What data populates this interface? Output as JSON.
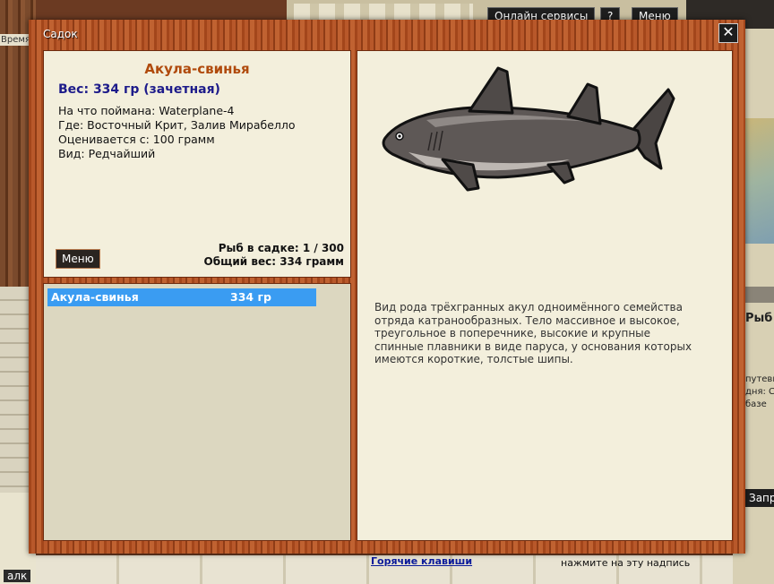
{
  "background": {
    "time_label": "Время:",
    "online_services": "Онлайн сервисы",
    "help": "?",
    "menu": "Меню",
    "right_fragments": [
      "Рыб",
      "путевк",
      "дня: С",
      "базе"
    ],
    "right_button": "Запр",
    "bottom_hint": "нажмите на эту надпись",
    "alk": "алк"
  },
  "dialog": {
    "title": "Садок",
    "close": "✕"
  },
  "fish": {
    "name": "Акула-свинья",
    "weight_line": "Вес: 334 гр (зачетная)",
    "details": [
      {
        "label": "На что поймана:",
        "value": "Waterplane-4"
      },
      {
        "label": "Где:",
        "value": "Восточный Крит, Залив Мирабелло"
      },
      {
        "label": "Оценивается с:",
        "value": "100 грамм"
      },
      {
        "label": "Вид:",
        "value": "Редчайший"
      }
    ],
    "description": "Вид рода трёхгранных акул одноимённого семейства отряда катранообразных. Тело массивное и высокое, треугольное в поперечнике, высокие и крупные спинные плавники в виде паруса, у основания которых имеются короткие, толстые шипы."
  },
  "info_panel": {
    "menu_button": "Меню",
    "fish_count": "Рыб в садке: 1 / 300",
    "total_weight": "Общий вес: 334 грамм"
  },
  "fish_list": [
    {
      "name": "Акула-свинья",
      "weight": "334 гр"
    }
  ],
  "links": {
    "hotkeys": "Горячие клавиши"
  },
  "colors": {
    "title": "#b04a0c",
    "weight": "#1d1b8a",
    "selection": "#3a9cf2",
    "link": "#0a1a9a"
  }
}
